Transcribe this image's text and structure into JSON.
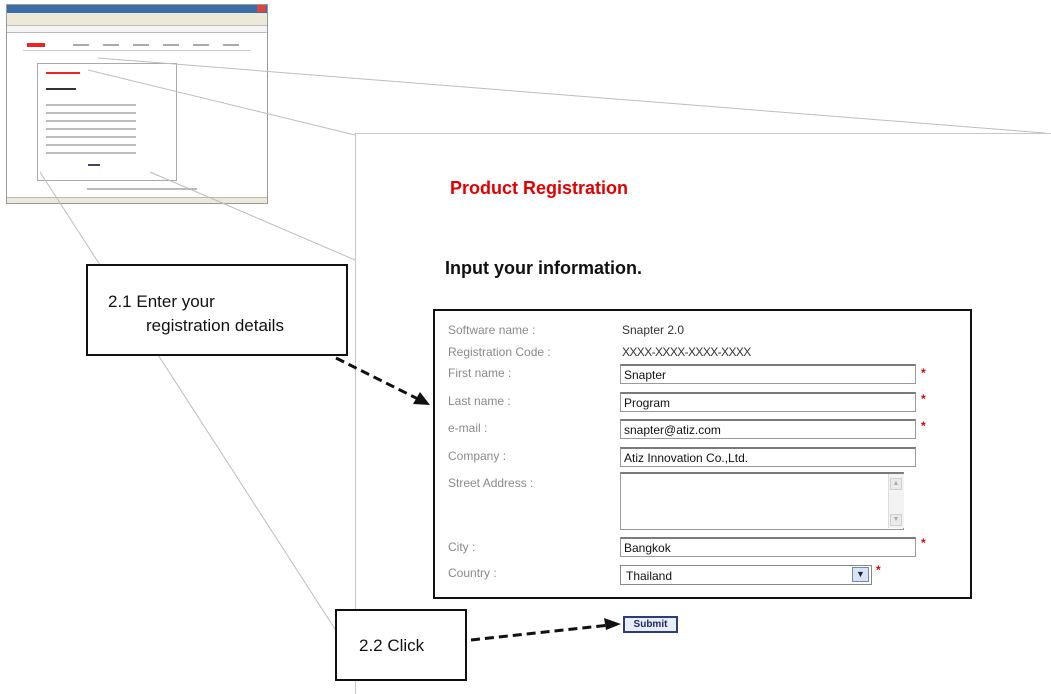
{
  "page": {
    "title": "Product Registration",
    "section_title": "Input your information."
  },
  "form": {
    "software_name": {
      "label": "Software name :",
      "value": "Snapter 2.0"
    },
    "registration_code": {
      "label": "Registration Code :",
      "value": "XXXX-XXXX-XXXX-XXXX"
    },
    "first_name": {
      "label": "First name :",
      "value": "Snapter",
      "required": "*"
    },
    "last_name": {
      "label": "Last name :",
      "value": "Program",
      "required": "*"
    },
    "email": {
      "label": "e-mail :",
      "value": "snapter@atiz.com",
      "required": "*"
    },
    "company": {
      "label": "Company :",
      "value": "Atiz Innovation Co.,Ltd."
    },
    "street_address": {
      "label": "Street Address :",
      "value": ""
    },
    "city": {
      "label": "City :",
      "value": "Bangkok",
      "required": "*"
    },
    "country": {
      "label": "Country :",
      "value": "Thailand",
      "required": "*"
    },
    "submit_label": "Submit"
  },
  "callouts": {
    "step1_line1": "2.1 Enter your",
    "step1_line2": "registration details",
    "step2": "2.2 Click"
  },
  "colors": {
    "title_red": "#e30000",
    "required_red": "#e30000",
    "submit_border": "#2b3e78"
  }
}
